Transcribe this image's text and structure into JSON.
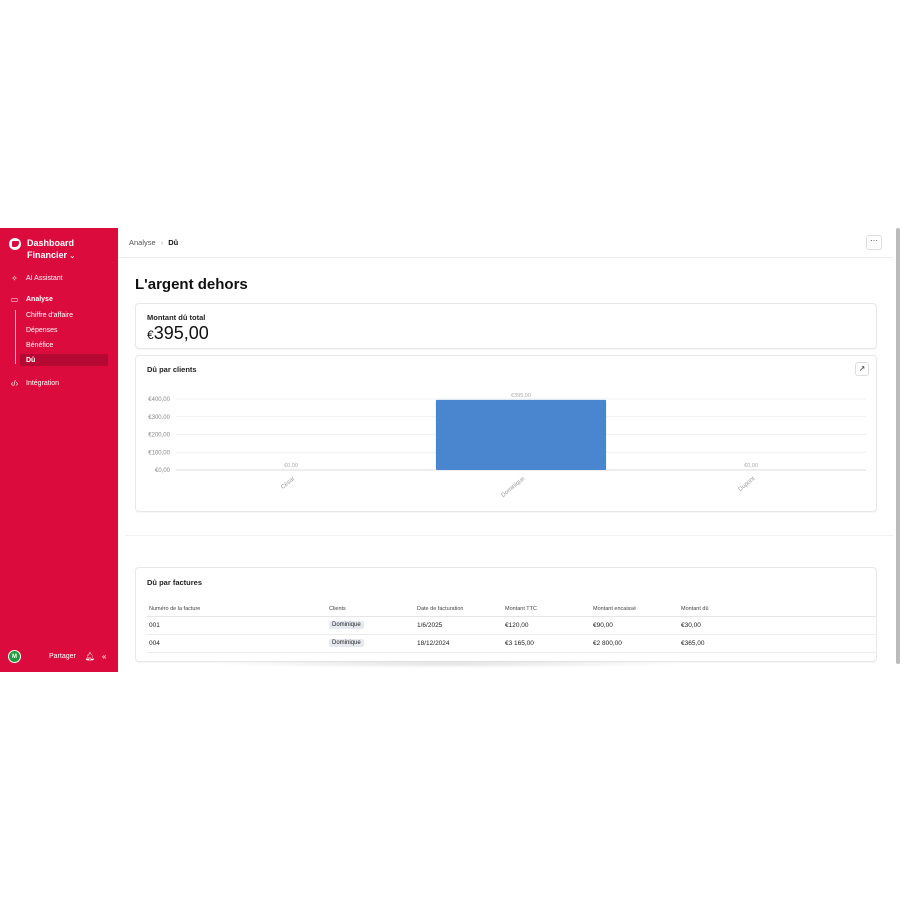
{
  "app": {
    "title_line1": "Dashboard",
    "title_line2": "Financier"
  },
  "sidebar": {
    "items": [
      {
        "label": "AI Assistant",
        "icon": "sparkle-icon"
      },
      {
        "label": "Analyse",
        "icon": "folder-icon"
      },
      {
        "label": "Intégration",
        "icon": "code-icon"
      }
    ],
    "sub_items": [
      {
        "label": "Chiffre d'affaire"
      },
      {
        "label": "Dépenses"
      },
      {
        "label": "Bénéfice"
      },
      {
        "label": "Dû"
      }
    ],
    "footer": {
      "avatar": "M",
      "share_label": "Partager"
    }
  },
  "header": {
    "breadcrumb": [
      "Analyse",
      "Dû"
    ],
    "more_label": "···"
  },
  "page": {
    "title": "L'argent dehors",
    "kpi_label": "Montant dû total",
    "kpi_currency": "€",
    "kpi_value": "395,00"
  },
  "chart_card": {
    "title": "Dû par clients",
    "expand_icon": "arrow-up-right-icon"
  },
  "chart_data": {
    "type": "bar",
    "categories": [
      "César",
      "Dominique",
      "Dupont"
    ],
    "values": [
      0,
      395,
      0
    ],
    "value_labels": [
      "€0,00",
      "€395,00",
      "€0,00"
    ],
    "yticks": [
      0,
      100,
      200,
      300,
      400
    ],
    "ytick_labels": [
      "€0,00",
      "€100,00",
      "€200,00",
      "€300,00",
      "€400,00"
    ],
    "ylim": [
      0,
      400
    ],
    "bar_color": "#4a86d0",
    "grid": true
  },
  "invoices": {
    "title": "Dû par factures",
    "columns": [
      "Numéro de la facture",
      "Clients",
      "Date de facturation",
      "Montant TTC",
      "Montant encaissé",
      "Montant dû"
    ],
    "rows": [
      [
        "001",
        "Dominique",
        "1/6/2025",
        "€120,00",
        "€90,00",
        "€30,00"
      ],
      [
        "004",
        "Dominique",
        "18/12/2024",
        "€3 165,00",
        "€2 800,00",
        "€365,00"
      ]
    ]
  },
  "colors": {
    "brand": "#dc0b3d",
    "active": "#b50832",
    "bar": "#4a86d0"
  }
}
